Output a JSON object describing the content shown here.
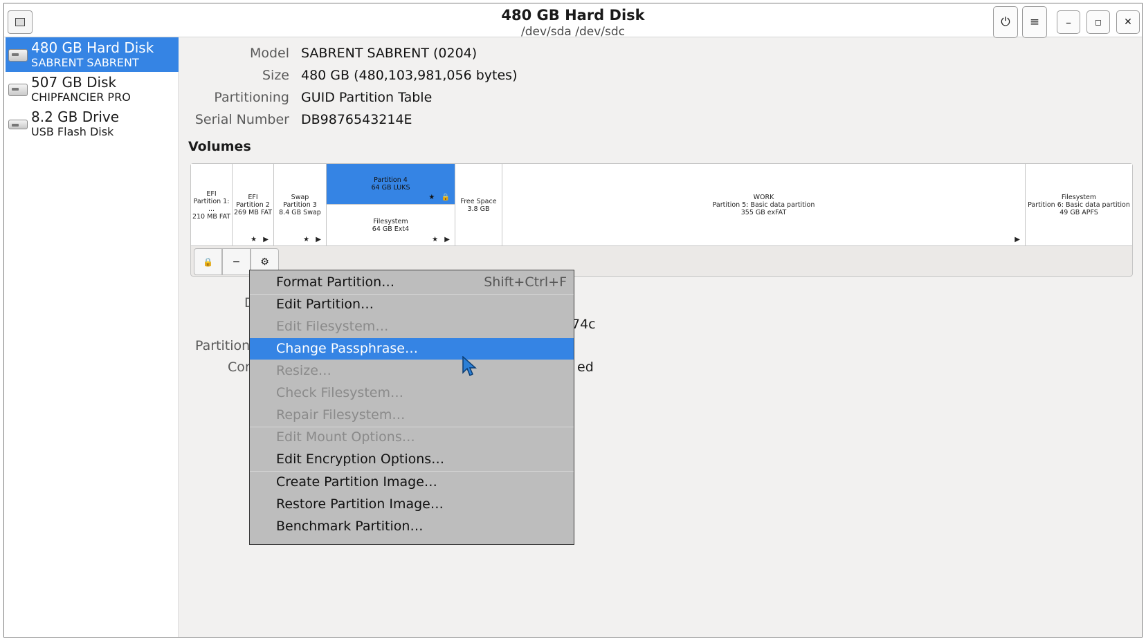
{
  "window": {
    "title": "480 GB Hard Disk",
    "subtitle": "/dev/sda /dev/sdc"
  },
  "header_buttons": {
    "power": "⏻",
    "menu": "≡",
    "minimize": "–",
    "maximize": "◻",
    "close": "✕"
  },
  "sidebar": {
    "devices": [
      {
        "name": "480 GB Hard Disk",
        "sub": "SABRENT SABRENT",
        "icon": "hard-disk-icon"
      },
      {
        "name": "507 GB Disk",
        "sub": "CHIPFANCIER PRO",
        "icon": "hard-disk-icon"
      },
      {
        "name": "8.2 GB Drive",
        "sub": "USB Flash Disk",
        "icon": "usb-drive-icon"
      }
    ]
  },
  "disk_info": [
    {
      "label": "Model",
      "value": "SABRENT SABRENT (0204)"
    },
    {
      "label": "Size",
      "value": "480 GB (480,103,981,056 bytes)"
    },
    {
      "label": "Partitioning",
      "value": "GUID Partition Table"
    },
    {
      "label": "Serial Number",
      "value": "DB9876543214E"
    }
  ],
  "volumes_heading": "Volumes",
  "partitions": [
    {
      "l1": "EFI",
      "l2": "Partition 1: ...",
      "l3": "210 MB FAT",
      "badge": ""
    },
    {
      "l1": "EFI",
      "l2": "Partition 2",
      "l3": "269 MB FAT",
      "badge": "★ ▶"
    },
    {
      "l1": "Swap",
      "l2": "Partition 3",
      "l3": "8.4 GB Swap",
      "badge": "★ ▶"
    },
    {
      "l1": "Partition 4",
      "l2": "64 GB LUKS",
      "l3": "",
      "badge": "★ 🔒"
    },
    {
      "l1": "Filesystem",
      "l2": "64 GB Ext4",
      "l3": "",
      "badge": "★ ▶"
    },
    {
      "l1": "Free Space",
      "l2": "3.8 GB",
      "l3": "",
      "badge": ""
    },
    {
      "l1": "WORK",
      "l2": "Partition 5: Basic data partition",
      "l3": "355 GB exFAT",
      "badge": "▶"
    },
    {
      "l1": "Filesystem",
      "l2": "Partition 6: Basic data partition",
      "l3": "49 GB APFS",
      "badge": ""
    }
  ],
  "volume_toolbar": {
    "lock": "🔒",
    "remove": "−",
    "gear": "⚙"
  },
  "details_fragments": {
    "d": "D",
    "uuid_tail": "74c",
    "partition_label": "Partition",
    "contents_label": "Cor",
    "contents_tail": "ed"
  },
  "context_menu": {
    "items": [
      {
        "label": "Format Partition…",
        "accel": "Shift+Ctrl+F",
        "enabled": true
      },
      {
        "label": "Edit Partition…",
        "accel": "",
        "enabled": true
      },
      {
        "label": "Edit Filesystem…",
        "accel": "",
        "enabled": false
      },
      {
        "label": "Change Passphrase…",
        "accel": "",
        "enabled": true
      },
      {
        "label": "Resize…",
        "accel": "",
        "enabled": false
      },
      {
        "label": "Check Filesystem…",
        "accel": "",
        "enabled": false
      },
      {
        "label": "Repair Filesystem…",
        "accel": "",
        "enabled": false
      },
      {
        "label": "Edit Mount Options…",
        "accel": "",
        "enabled": false
      },
      {
        "label": "Edit Encryption Options…",
        "accel": "",
        "enabled": true
      },
      {
        "label": "Create Partition Image…",
        "accel": "",
        "enabled": true
      },
      {
        "label": "Restore Partition Image…",
        "accel": "",
        "enabled": true
      },
      {
        "label": "Benchmark Partition…",
        "accel": "",
        "enabled": true
      }
    ],
    "highlighted": "Change Passphrase…"
  },
  "colors": {
    "accent": "#3584e4",
    "menu_bg": "#bdbdbd",
    "disabled_text": "#8a8a8a"
  }
}
